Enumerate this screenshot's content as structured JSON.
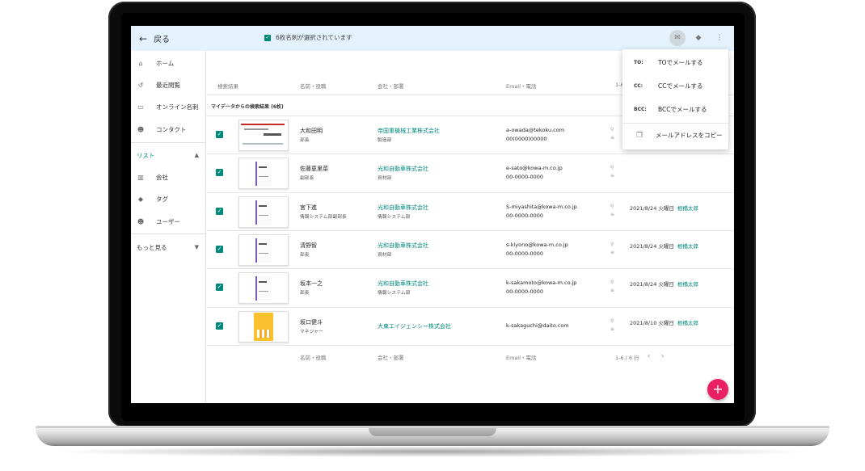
{
  "topbar": {
    "back_label": "戻る",
    "selection_text": "6枚名刺が選択されています"
  },
  "sidebar": {
    "items": [
      {
        "label": "ホーム",
        "icon": "home-icon"
      },
      {
        "label": "最近閲覧",
        "icon": "history-icon"
      },
      {
        "label": "オンライン名刺",
        "icon": "card-icon"
      },
      {
        "label": "コンタクト",
        "icon": "contacts-icon"
      }
    ],
    "section_label": "リスト",
    "list_items": [
      {
        "label": "会社",
        "icon": "company-icon"
      },
      {
        "label": "タグ",
        "icon": "tag-icon"
      },
      {
        "label": "ユーザー",
        "icon": "users-icon"
      }
    ],
    "more_label": "もっと見る"
  },
  "table": {
    "headers": {
      "search": "検索結果",
      "name": "名前・役職",
      "company": "会社・部署",
      "email": "Email・電話",
      "date": "1-6"
    },
    "subheader": "マイデータからの検索結果 (6枚)",
    "rows": [
      {
        "name": "大和田明",
        "title": "部長",
        "company": "帝国重機械工業株式会社",
        "dept": "製造部",
        "email": "a-owada@tekoku.com",
        "phone": "00(0000)00000",
        "date": "",
        "owner": ""
      },
      {
        "name": "佐藤恵里菜",
        "title": "副部長",
        "company": "光和自動車株式会社",
        "dept": "資材部",
        "email": "e-sato@kowa-m.co.jp",
        "phone": "00-0000-0000",
        "date": "",
        "owner": ""
      },
      {
        "name": "宮下進",
        "title": "情報システム部副部長",
        "company": "光和自動車株式会社",
        "dept": "情報システム部",
        "email": "S-miyashita@kowa-m.co.jp",
        "phone": "00-0000-0000",
        "date": "2021/8/24 火曜日",
        "owner": "根橋太郎"
      },
      {
        "name": "清野智",
        "title": "部長",
        "company": "光和自動車株式会社",
        "dept": "資材部",
        "email": "s-kiyono@kowa-m.co.jp",
        "phone": "00-0000-0000",
        "date": "2021/8/24 火曜日",
        "owner": "根橋太郎"
      },
      {
        "name": "坂本一之",
        "title": "部長",
        "company": "光和自動車株式会社",
        "dept": "情報システム部",
        "email": "k-sakamoto@kowa-m.co.jp",
        "phone": "00-0000-0000",
        "date": "2021/8/24 火曜日",
        "owner": "根橋太郎"
      },
      {
        "name": "坂口健斗",
        "title": "マネジャー",
        "company": "大東エイジェンシー株式会社",
        "dept": "",
        "email": "k-sakaguchi@daito.com",
        "phone": "",
        "date": "2021/8/10 火曜日",
        "owner": "根橋太郎"
      }
    ],
    "footer": {
      "name": "名前・役職",
      "company": "会社・部署",
      "email": "Email・電話",
      "pager": "1-6 / 6 行"
    }
  },
  "menu": {
    "items": [
      {
        "tag": "TO:",
        "label": "TOでメールする"
      },
      {
        "tag": "CC:",
        "label": "CCでメールする"
      },
      {
        "tag": "BCC:",
        "label": "BCCでメールする"
      }
    ],
    "copy_label": "メールアドレスをコピー"
  },
  "colors": {
    "accent": "#00897b",
    "topbar": "#e3f2fd",
    "fab": "#e91e63"
  }
}
